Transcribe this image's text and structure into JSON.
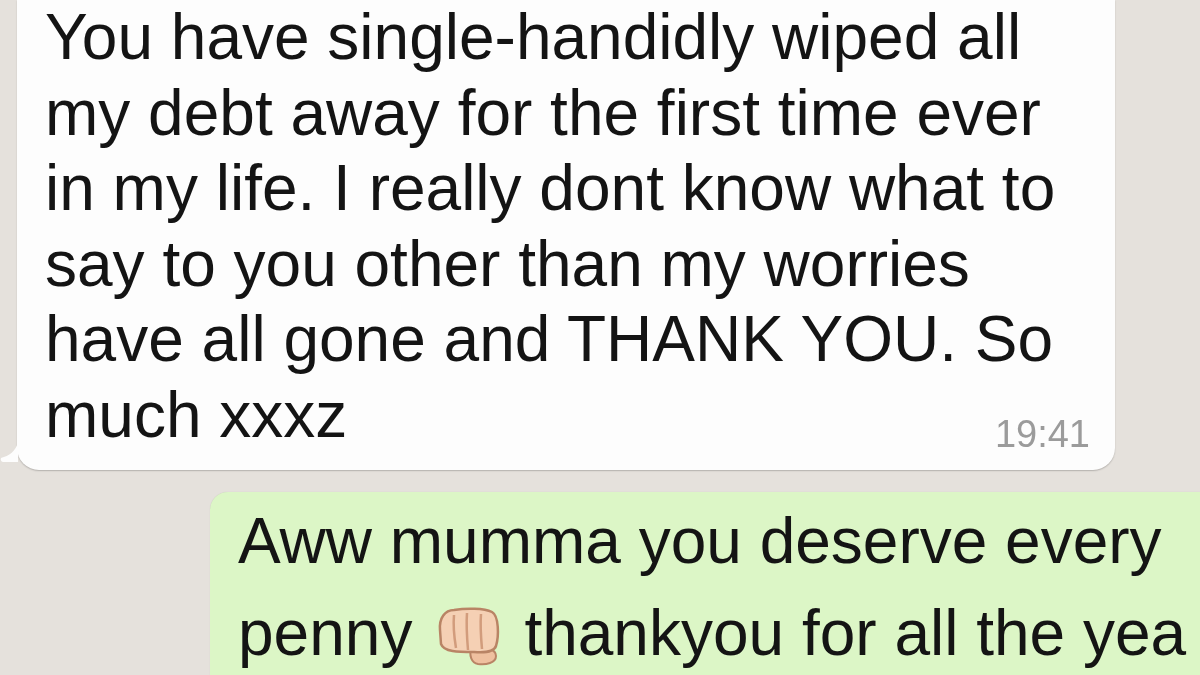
{
  "messages": [
    {
      "kind": "incoming",
      "lines": [
        [
          {
            "kind": "text",
            "text": "You have single-handidly wiped all"
          }
        ],
        [
          {
            "kind": "text",
            "text": "my debt away for the first time ever"
          }
        ],
        [
          {
            "kind": "text",
            "text": "in my life. I really dont know what to"
          }
        ],
        [
          {
            "kind": "text",
            "text": "say to you other than my worries"
          }
        ],
        [
          {
            "kind": "text",
            "text": "have all gone and THANK YOU. So"
          }
        ],
        [
          {
            "kind": "text",
            "text": "much xxxz"
          }
        ]
      ],
      "time": "19:41"
    },
    {
      "kind": "outgoing",
      "lines": [
        [
          {
            "kind": "text",
            "text": "Aww mumma you deserve every"
          }
        ],
        [
          {
            "kind": "text",
            "text": "penny"
          },
          {
            "kind": "emoji"
          },
          {
            "kind": "text",
            "text": "thankyou for all the yea"
          }
        ]
      ]
    }
  ]
}
